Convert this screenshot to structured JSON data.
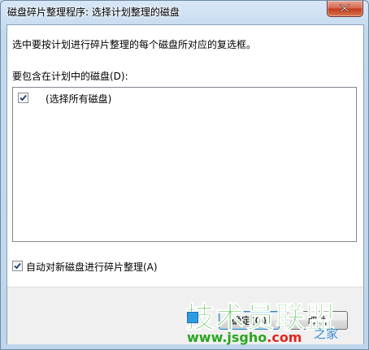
{
  "window": {
    "title": "磁盘碎片整理程序: 选择计划整理的磁盘"
  },
  "content": {
    "instruction": "选中要按计划进行碎片整理的每个磁盘所对应的复选框。",
    "disk_list_label": "要包含在计划中的磁盘(D):",
    "disk_items": [
      {
        "label": "(选择所有磁盘)",
        "checked": true
      }
    ],
    "auto_defrag_label": "自动对新磁盘进行碎片整理(A)",
    "auto_defrag_checked": true
  },
  "buttons": {
    "ok_label": "确定(O)",
    "cancel_label": "取消"
  },
  "watermark": {
    "main": "技术员联盟",
    "url_prefix": "www.",
    "url_domain": "jsgho",
    "url_suffix": ".com",
    "tag": "之家"
  },
  "colors": {
    "title_bar": "#c3d9ee",
    "close_button": "#c2391e",
    "watermark_green": "#38b22e"
  }
}
